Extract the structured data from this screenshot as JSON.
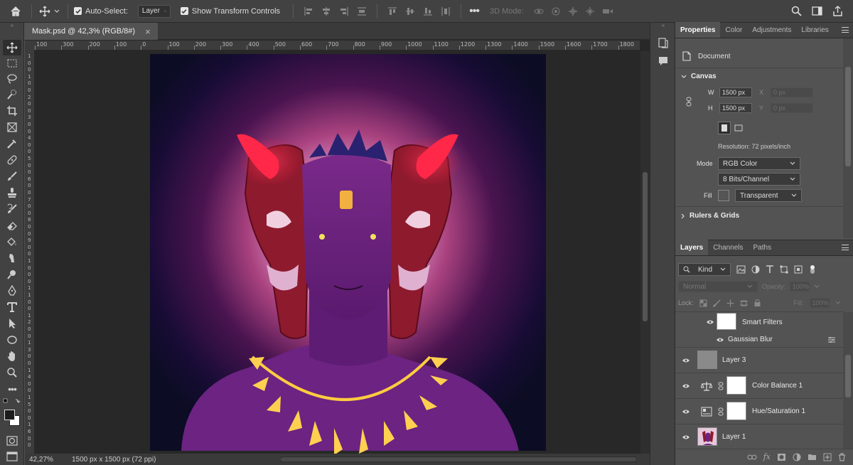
{
  "options_bar": {
    "auto_select_label": "Auto-Select:",
    "auto_select_target": "Layer",
    "show_transform_label": "Show Transform Controls",
    "mode_3d_label": "3D Mode:"
  },
  "document": {
    "tab_title": "Mask.psd @ 42,3% (RGB/8#)",
    "close_symbol": "×"
  },
  "rulers": {
    "horizontal": [
      "100",
      "300",
      "200",
      "100",
      "0",
      "100",
      "200",
      "300",
      "400",
      "500",
      "600",
      "700",
      "800",
      "900",
      "1000",
      "1100",
      "1200",
      "1300",
      "1400",
      "1500",
      "1600",
      "1700",
      "1800"
    ],
    "vertical": [
      "1",
      "0",
      "0",
      "1",
      "0",
      "0",
      "2",
      "0",
      "0",
      "3",
      "0",
      "0",
      "4",
      "0",
      "0",
      "5",
      "0",
      "0",
      "6",
      "0",
      "0",
      "7",
      "0",
      "0",
      "8",
      "0",
      "0",
      "9",
      "0",
      "0",
      "1",
      "0",
      "0",
      "0",
      "1",
      "1",
      "0",
      "0",
      "1",
      "2",
      "0",
      "0",
      "1",
      "3",
      "0",
      "0",
      "1",
      "4",
      "0",
      "0",
      "1",
      "5",
      "0",
      "0",
      "1",
      "6",
      "0",
      "0"
    ]
  },
  "status": {
    "zoom": "42,27%",
    "doc_info": "1500 px x 1500 px (72 ppi)"
  },
  "properties": {
    "tabs": [
      "Properties",
      "Color",
      "Adjustments",
      "Libraries"
    ],
    "active_tab": 0,
    "type_label": "Document",
    "canvas_header": "Canvas",
    "w_label": "W",
    "w_value": "1500 px",
    "h_label": "H",
    "h_value": "1500 px",
    "x_label": "X",
    "x_value": "0 px",
    "y_label": "Y",
    "y_value": "0 px",
    "resolution": "Resolution: 72 pixels/inch",
    "mode_label": "Mode",
    "mode_value": "RGB Color",
    "bits_value": "8 Bits/Channel",
    "fill_label": "Fill",
    "fill_value": "Transparent",
    "rulers_header": "Rulers & Grids"
  },
  "layers": {
    "tabs": [
      "Layers",
      "Channels",
      "Paths"
    ],
    "active_tab": 0,
    "filter_kind": "Kind",
    "blend_mode": "Normal",
    "opacity_label": "Opacity:",
    "opacity_value": "100%",
    "lock_label": "Lock:",
    "fill_label": "Fill:",
    "fill_value": "100%",
    "items": [
      {
        "name": "Smart Filters",
        "type": "smart-filters"
      },
      {
        "name": "Gaussian Blur",
        "type": "filter"
      },
      {
        "name": "Layer 3",
        "type": "gray"
      },
      {
        "name": "Color Balance 1",
        "type": "adjustment"
      },
      {
        "name": "Hue/Saturation 1",
        "type": "adjustment"
      },
      {
        "name": "Layer 1",
        "type": "image"
      }
    ]
  },
  "colors": {
    "accent": "#1473e6",
    "panel_bg": "#535353",
    "chrome_bg": "#424242"
  }
}
